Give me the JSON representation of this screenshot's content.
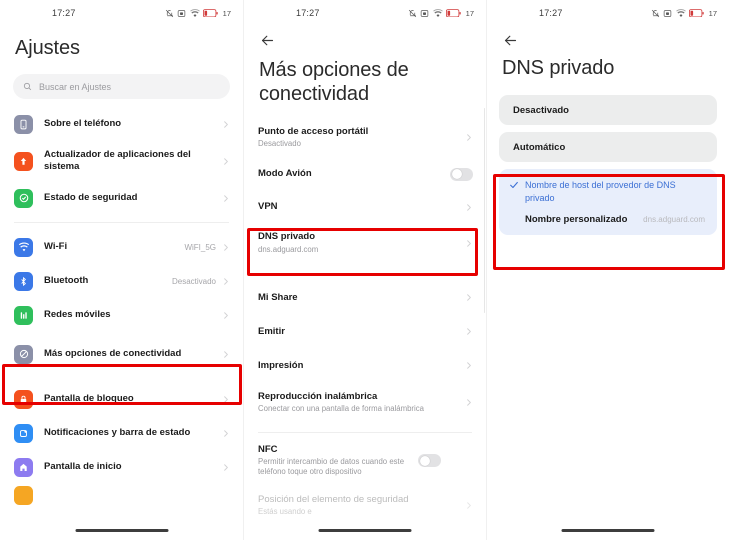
{
  "status_bar": {
    "time": "17:27",
    "battery_percent": "17",
    "icons": [
      "bell-muted-icon",
      "alarm-icon",
      "wifi-icon",
      "battery-low-icon"
    ]
  },
  "panel_settings": {
    "title": "Ajustes",
    "search": {
      "placeholder": "Buscar en Ajustes",
      "icon": "search-icon"
    },
    "groups": [
      {
        "items": [
          {
            "label": "Sobre el teléfono",
            "icon": "phone-icon",
            "icon_color": "#8b90a8",
            "chevron": true
          },
          {
            "label": "Actualizador de aplicaciones del sistema",
            "icon": "update-arrow-icon",
            "icon_color": "#f4511e",
            "chevron": true
          },
          {
            "label": "Estado de seguridad",
            "icon": "shield-check-icon",
            "icon_color": "#2fbf5c",
            "chevron": true
          }
        ]
      },
      {
        "items": [
          {
            "label": "Wi-Fi",
            "icon": "wifi-icon",
            "icon_color": "#3b78e7",
            "value": "WiFI_5G",
            "chevron": true
          },
          {
            "label": "Bluetooth",
            "icon": "bluetooth-icon",
            "icon_color": "#3b78e7",
            "value": "Desactivado",
            "chevron": true
          },
          {
            "label": "Redes móviles",
            "icon": "cellular-icon",
            "icon_color": "#2fbf5c",
            "chevron": true
          },
          {
            "label": "Más opciones de conectividad",
            "icon": "connectivity-off-icon",
            "icon_color": "#8b90a8",
            "chevron": true,
            "highlighted": true
          }
        ]
      },
      {
        "items": [
          {
            "label": "Pantalla de bloqueo",
            "icon": "lock-icon",
            "icon_color": "#f4511e",
            "chevron": true
          },
          {
            "label": "Notificaciones y barra de estado",
            "icon": "notifications-icon",
            "icon_color": "#2f8ef4",
            "chevron": true
          },
          {
            "label": "Pantalla de inicio",
            "icon": "home-icon",
            "icon_color": "#8d7bf0",
            "chevron": true
          }
        ]
      }
    ]
  },
  "panel_connectivity": {
    "back_icon": "back-arrow-icon",
    "title": "Más opciones de conectividad",
    "groups": [
      {
        "items": [
          {
            "label": "Punto de acceso portátil",
            "sub": "Desactivado",
            "chevron": true
          },
          {
            "label": "Modo Avión",
            "toggle": "off"
          },
          {
            "label": "VPN",
            "chevron": true
          },
          {
            "label": "DNS privado",
            "sub": "dns.adguard.com",
            "chevron": true,
            "highlighted": true
          }
        ]
      },
      {
        "items": [
          {
            "label": "Mi Share",
            "chevron": true
          },
          {
            "label": "Emitir",
            "chevron": true
          },
          {
            "label": "Impresión",
            "chevron": true
          },
          {
            "label": "Reproducción inalámbrica",
            "sub": "Conectar con una pantalla de forma inalámbrica",
            "chevron": true
          }
        ]
      },
      {
        "items": [
          {
            "label": "NFC",
            "sub": "Permitir intercambio de datos cuando este teléfono toque otro dispositivo",
            "toggle": "off"
          },
          {
            "label": "Posición del elemento de seguridad",
            "sub": "Estás usando e",
            "chevron": true,
            "faded": true
          }
        ]
      }
    ]
  },
  "panel_private_dns": {
    "back_icon": "back-arrow-icon",
    "title": "DNS privado",
    "options": [
      {
        "label": "Desactivado",
        "selected": false
      },
      {
        "label": "Automático",
        "selected": false
      }
    ],
    "selected_group": {
      "selected_label": "Nombre de host del provedor de DNS privado",
      "check_icon": "check-icon",
      "custom_label": "Nombre personalizado",
      "custom_value": "dns.adguard.com",
      "highlighted": true
    }
  },
  "annotation": {
    "color": "#e60000"
  }
}
